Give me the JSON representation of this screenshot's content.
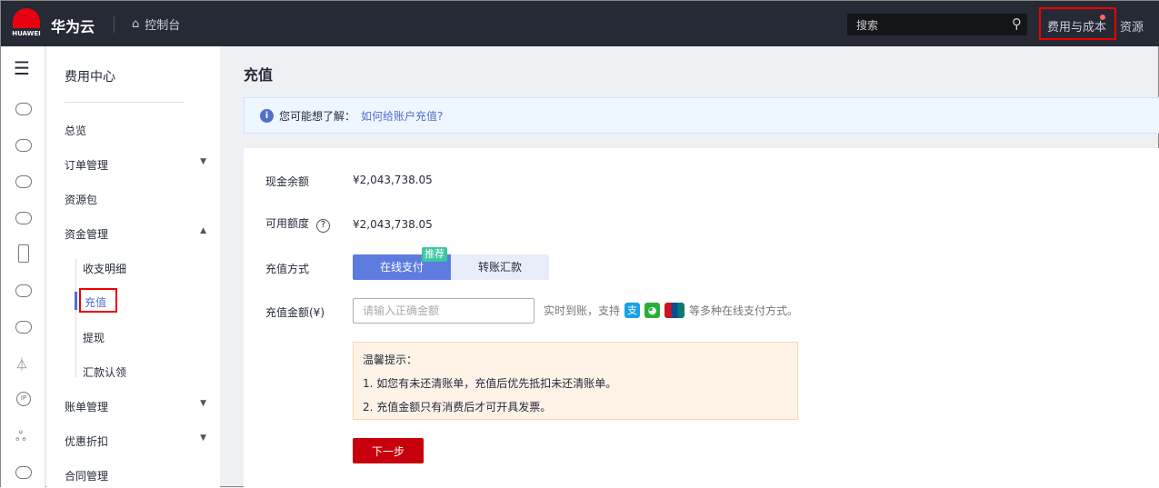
{
  "header": {
    "logo_text": "HUAWEI",
    "brand": "华为云",
    "console": "控制台",
    "search_placeholder": "搜索",
    "fee_cost": "费用与成本",
    "resources": "资源"
  },
  "nav": {
    "title": "费用中心",
    "items": [
      {
        "label": "总览",
        "arrow": ""
      },
      {
        "label": "订单管理",
        "arrow": "▼"
      },
      {
        "label": "资源包",
        "arrow": ""
      },
      {
        "label": "资金管理",
        "arrow": "▲"
      }
    ],
    "sub_items": [
      "收支明细",
      "充值",
      "提现",
      "汇款认领"
    ],
    "items_after": [
      {
        "label": "账单管理",
        "arrow": "▼"
      },
      {
        "label": "优惠折扣",
        "arrow": "▼"
      },
      {
        "label": "合同管理",
        "arrow": ""
      }
    ]
  },
  "main": {
    "title": "充值",
    "tip_prefix": "您可能想了解：",
    "tip_link": "如何给账户充值?",
    "cash_balance_label": "现金余额",
    "cash_balance": "¥2,043,738.05",
    "available_label": "可用额度",
    "available": "¥2,043,738.05",
    "method_label": "充值方式",
    "method_online": "在线支付",
    "method_transfer": "转账汇款",
    "recommend_badge": "推荐",
    "amount_label": "充值金额(¥)",
    "amount_placeholder": "请输入正确金额",
    "pay_info_prefix": "实时到账，支持",
    "pay_info_suffix": "等多种在线支付方式。",
    "notice_title": "温馨提示：",
    "notice_1": "1. 如您有未还清账单，充值后优先抵扣未还清账单。",
    "notice_2": "2. 充值金额只有消费后才可开具发票。",
    "next_button": "下一步"
  },
  "colors": {
    "header": "#262a35",
    "accent": "#5e7ce0",
    "primary_button": "#c7000b",
    "highlight_box": "#ff0000"
  }
}
